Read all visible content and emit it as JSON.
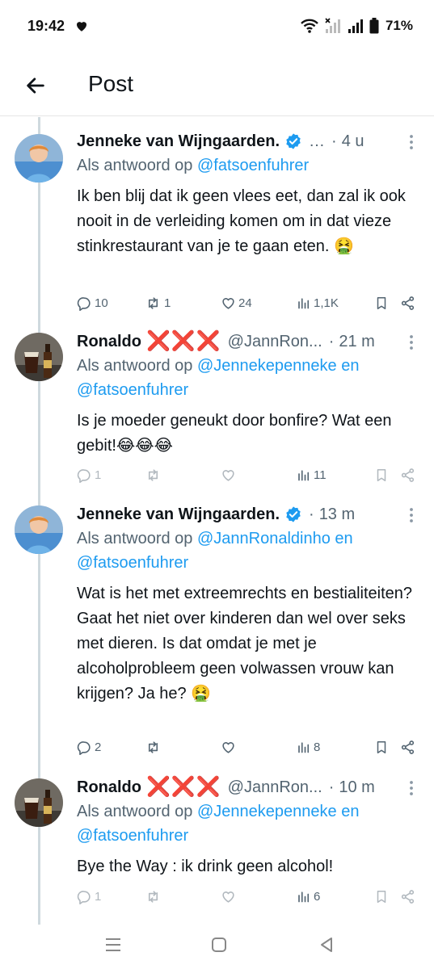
{
  "status_bar": {
    "time": "19:42",
    "battery": "71%"
  },
  "header": {
    "title": "Post"
  },
  "tweets": [
    {
      "author": "Jenneke van Wijngaarden.",
      "handle": "…",
      "dot": "·",
      "time": "4 u",
      "reply_prefix": "Als antwoord op",
      "mentions": "@fatsoenfuhrer",
      "mentions_2": "",
      "text": "Ik ben blij dat ik geen vlees eet, dan zal ik ook nooit in de verleiding komen om in dat vieze stinkrestaurant van je te gaan eten. 🤮",
      "replies": "10",
      "reposts": "1",
      "likes": "24",
      "views": "1,1K"
    },
    {
      "author": "Ronaldo",
      "marks": "❌❌❌",
      "handle": "@JannRon...",
      "dot": "·",
      "time": "21 m",
      "reply_prefix": "Als antwoord op",
      "mentions": "@Jennekepenneke en",
      "mentions_2": "@fatsoenfuhrer",
      "text": "Is je moeder geneukt door bonfire? Wat een gebit!😂😂😂",
      "replies": "1",
      "reposts": "",
      "likes": "",
      "views": "11"
    },
    {
      "author": "Jenneke van Wijngaarden.",
      "handle": "",
      "dot": "·",
      "time": "13 m",
      "reply_prefix": "Als antwoord op",
      "mentions": "@JannRonaldinho en",
      "mentions_2": "@fatsoenfuhrer",
      "text": "Wat is het met extreemrechts en bestialiteiten? Gaat het niet over kinderen dan wel over seks met dieren. Is dat omdat je met je alcoholprobleem geen volwassen vrouw kan krijgen? Ja he? 🤮",
      "replies": "2",
      "reposts": "",
      "likes": "",
      "views": "8"
    },
    {
      "author": "Ronaldo",
      "marks": "❌❌❌",
      "handle": "@JannRon...",
      "dot": "·",
      "time": "10 m",
      "reply_prefix": "Als antwoord op",
      "mentions": "@Jennekepenneke en",
      "mentions_2": "@fatsoenfuhrer",
      "text": "Bye the Way : ik drink geen alcohol!",
      "replies": "1",
      "reposts": "",
      "likes": "",
      "views": "6"
    }
  ],
  "icons": {
    "back": "arrow-left-icon",
    "verified": "verified-badge-icon",
    "more": "more-vertical-icon",
    "reply": "reply-icon",
    "repost": "repost-icon",
    "like": "heart-icon",
    "views": "views-icon",
    "bookmark": "bookmark-icon",
    "share": "share-icon",
    "nav_recents": "recents-icon",
    "nav_home": "home-icon",
    "nav_back": "back-triangle-icon"
  },
  "colors": {
    "link": "#1d9bf0",
    "secondary": "#536471",
    "verified": "#1d9bf0",
    "marks": "#e0242a"
  }
}
